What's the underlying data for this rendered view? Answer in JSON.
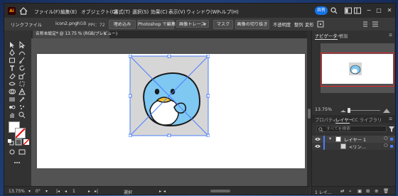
{
  "app": {
    "logo": "Ai",
    "menu": [
      "ファイル(F)",
      "編集(E)",
      "オブジェクト(O)",
      "書式(T)",
      "選択(S)",
      "効果(C)",
      "表示(V)",
      "ウィンドウ(W)",
      "ヘルプ(H)"
    ],
    "share_label": "共有",
    "accent_color": "#1473e6"
  },
  "control_bar": {
    "link_file": "リンクファイル",
    "file_name": "icon2.png",
    "color_info": "RGB",
    "ppi": "PPI：72",
    "embed": "埋め込み",
    "edit_photoshop": "Photoshop で編集",
    "image_trace": "画像トレース",
    "mask": "マスク",
    "crop_image": "画像の切り抜き",
    "opacity": "不透明度",
    "align": "整列",
    "transform": "変形"
  },
  "document": {
    "tab_title": "名称未設定* @ 13.75 % (RGB/プレビュー)",
    "close": "×"
  },
  "status_bar": {
    "zoom": "13.75%",
    "rotation": "0°",
    "artboard_index": "1",
    "tool_name": "選択"
  },
  "panels": {
    "top_tabs": [
      "ナビゲーター",
      "情報"
    ],
    "nav_zoom": "13.75%",
    "layer_tabs": [
      "プロパティ",
      "レイヤー",
      "CC ライブラリ"
    ],
    "search_placeholder": "すべてを検索",
    "layers": [
      {
        "name": "レイヤー 1",
        "color": "#4a7cff"
      },
      {
        "name": "<リン…",
        "color": "#4a7cff"
      }
    ],
    "footer": "1 レイ…"
  }
}
